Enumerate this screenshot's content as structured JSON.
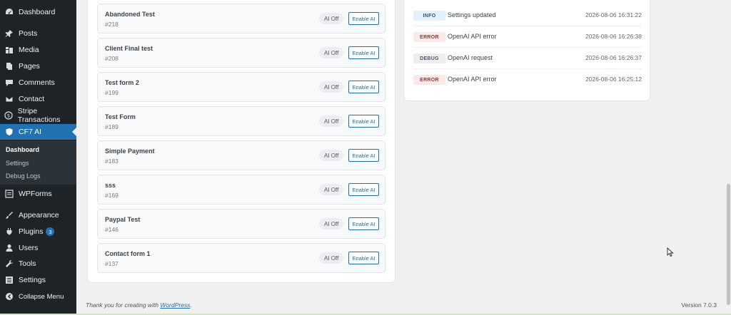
{
  "sidebar": {
    "items": [
      {
        "label": "Dashboard",
        "icon": "dashboard-icon"
      },
      {
        "label": "Posts",
        "icon": "pin-icon"
      },
      {
        "label": "Media",
        "icon": "media-icon"
      },
      {
        "label": "Pages",
        "icon": "pages-icon"
      },
      {
        "label": "Comments",
        "icon": "comments-icon"
      },
      {
        "label": "Contact",
        "icon": "mail-icon"
      },
      {
        "label": "Stripe Transactions",
        "icon": "dollar-icon"
      },
      {
        "label": "CF7 AI",
        "icon": "shield-icon"
      },
      {
        "label": "WPForms",
        "icon": "forms-icon"
      },
      {
        "label": "Appearance",
        "icon": "brush-icon"
      },
      {
        "label": "Plugins",
        "icon": "plugin-icon",
        "badge": "3"
      },
      {
        "label": "Users",
        "icon": "user-icon"
      },
      {
        "label": "Tools",
        "icon": "wrench-icon"
      },
      {
        "label": "Settings",
        "icon": "settings-icon"
      },
      {
        "label": "Collapse Menu",
        "icon": "collapse-icon"
      }
    ],
    "submenu": [
      "Dashboard",
      "Settings",
      "Debug Logs"
    ]
  },
  "forms": [
    {
      "name": "Abandoned Test",
      "id": "#218",
      "status": "AI Off",
      "action": "Enable AI"
    },
    {
      "name": "Client Final test",
      "id": "#208",
      "status": "AI Off",
      "action": "Enable AI"
    },
    {
      "name": "Test form 2",
      "id": "#199",
      "status": "AI Off",
      "action": "Enable AI"
    },
    {
      "name": "Test Form",
      "id": "#189",
      "status": "AI Off",
      "action": "Enable AI"
    },
    {
      "name": "Simple Payment",
      "id": "#183",
      "status": "AI Off",
      "action": "Enable AI"
    },
    {
      "name": "sss",
      "id": "#169",
      "status": "AI Off",
      "action": "Enable AI"
    },
    {
      "name": "Paypal Test",
      "id": "#146",
      "status": "AI Off",
      "action": "Enable AI"
    },
    {
      "name": "Contact form 1",
      "id": "#137",
      "status": "AI Off",
      "action": "Enable AI"
    }
  ],
  "logs": [
    {
      "level": "INFO",
      "message": "Settings updated",
      "time": "2026-08-06 16:31:22"
    },
    {
      "level": "ERROR",
      "message": "OpenAI API error",
      "time": "2026-08-06 16:26:38"
    },
    {
      "level": "DEBUG",
      "message": "OpenAI request",
      "time": "2026-08-06 16:26:37"
    },
    {
      "level": "ERROR",
      "message": "OpenAI API error",
      "time": "2026-08-06 16:25:12"
    }
  ],
  "footer": {
    "thanks_prefix": "Thank you for creating with ",
    "thanks_link": "WordPress",
    "thanks_suffix": ".",
    "version": "Version 7.0.3"
  },
  "colors": {
    "sidebar_bg": "#1d2327",
    "accent": "#2271b1",
    "info_bg": "#e5f0fa",
    "error_bg": "#fbeaea",
    "debug_bg": "#eceef1"
  }
}
